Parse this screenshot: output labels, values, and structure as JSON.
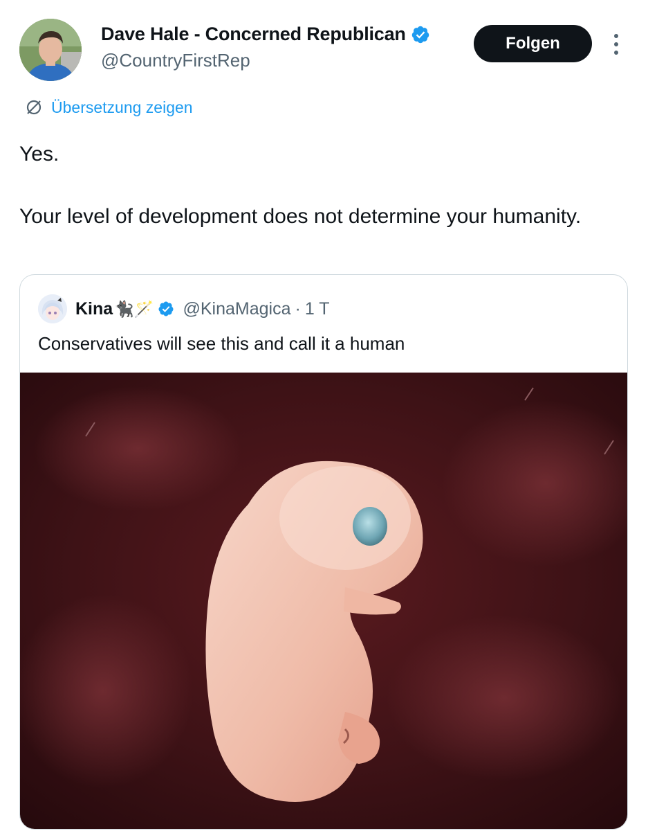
{
  "tweet": {
    "author": {
      "name": "Dave Hale - Concerned Republican",
      "handle": "@CountryFirstRep",
      "verified": true
    },
    "follow_label": "Folgen",
    "more_icon": "more-vertical-icon",
    "translate_label": "Übersetzung zeigen",
    "translate_icon": "translate-globe-icon",
    "text_lines": [
      "Yes.",
      "Your level of development does not determine your humanity."
    ]
  },
  "quote": {
    "author": {
      "name": "Kina",
      "emoji": "🐈‍⬛🪄",
      "handle": "@KinaMagica",
      "separator": "·",
      "time": "1 T",
      "verified": true
    },
    "text": "Conservatives will see this and call it a human",
    "image_subject": "embryo-photo"
  },
  "colors": {
    "accent": "#1d9bf0",
    "text": "#0f1419",
    "secondary": "#536471",
    "border": "#cfd9de",
    "follow_bg": "#0f1419"
  }
}
